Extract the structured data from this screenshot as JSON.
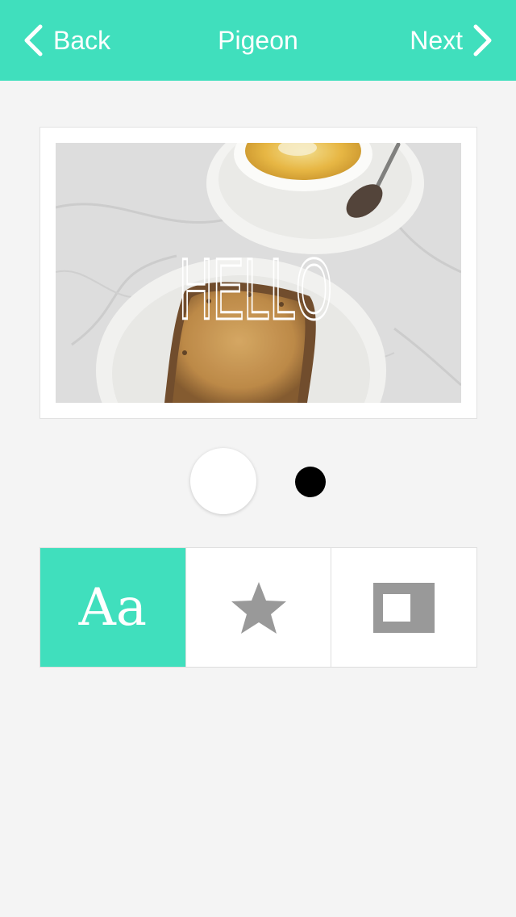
{
  "nav": {
    "back_label": "Back",
    "title": "Pigeon",
    "next_label": "Next",
    "back_icon": "chevron-left-icon",
    "next_icon": "chevron-right-icon",
    "background": "#40dfbd"
  },
  "card": {
    "overlay_text": "HELLO",
    "photo_subject": "toast with peanut butter and coffee cup on marble table"
  },
  "swatches": [
    {
      "name": "white",
      "color": "#ffffff"
    },
    {
      "name": "black",
      "color": "#000000"
    }
  ],
  "tools": [
    {
      "name": "text-tool",
      "label": "Aa",
      "icon": "text-icon",
      "selected": true
    },
    {
      "name": "sticker-tool",
      "icon": "star-icon",
      "selected": false
    },
    {
      "name": "frame-tool",
      "icon": "frame-icon",
      "selected": false
    }
  ],
  "colors": {
    "accent": "#40dfbd",
    "icon_gray": "#999999",
    "background": "#f4f4f4"
  }
}
